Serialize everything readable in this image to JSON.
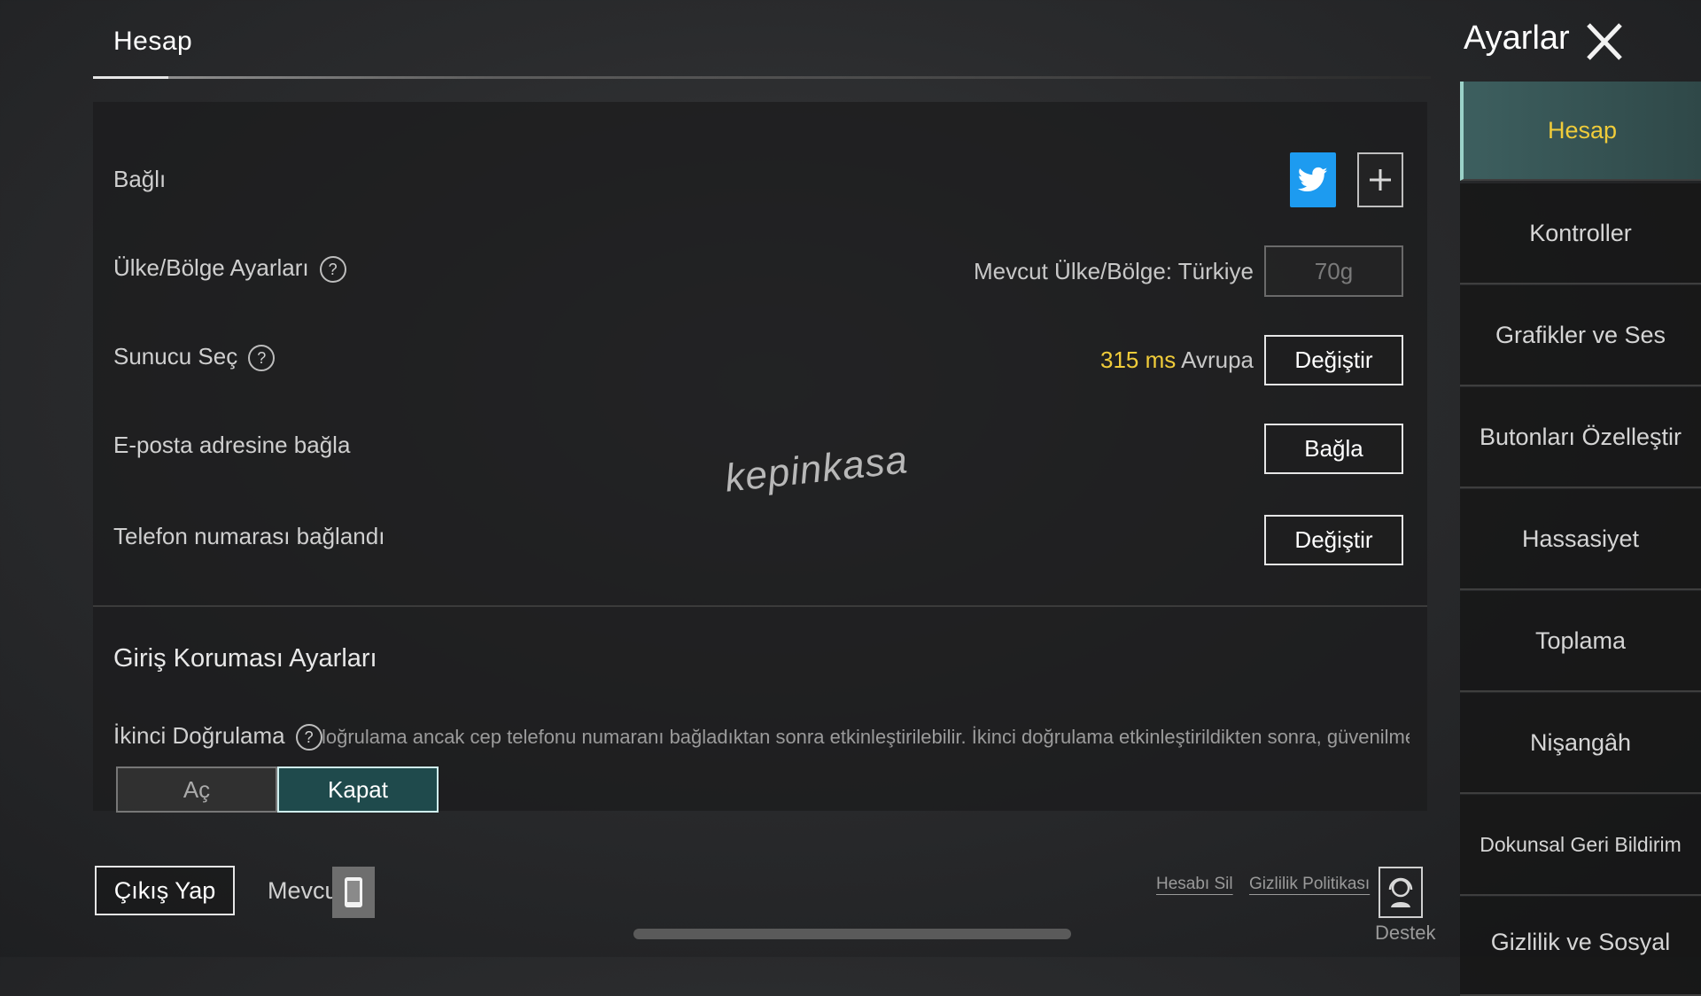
{
  "header": {
    "section_title": "Hesap"
  },
  "settings": {
    "title": "Ayarlar",
    "close_icon": "close-icon"
  },
  "rows": {
    "linked": {
      "label": "Bağlı",
      "twitter_icon": "twitter-icon",
      "add_icon": "plus-icon"
    },
    "region": {
      "label": "Ülke/Bölge Ayarları",
      "current": "Mevcut Ülke/Bölge: Türkiye",
      "button": "70g"
    },
    "server": {
      "label": "Sunucu Seç",
      "ping": "315 ms",
      "region": "Avrupa",
      "button": "Değiştir"
    },
    "email": {
      "label": "E-posta adresine bağla",
      "button": "Bağla"
    },
    "phone": {
      "label": "Telefon numarası bağlandı",
      "button": "Değiştir"
    }
  },
  "login_protection": {
    "title": "Giriş Koruması Ayarları",
    "second_auth_label": "İkinci Doğrulama",
    "second_auth_desc": "loğrulama ancak cep telefonu numaranı bağladıktan sonra etkinleştirilebilir. İkinci doğrulama etkinleştirildikten sonra, güvenilmeyen cihazlardan oyuna g",
    "on_label": "Aç",
    "off_label": "Kapat",
    "selected": "Kapat"
  },
  "bottom": {
    "logout": "Çıkış Yap",
    "current": "Mevcut",
    "delete_account": "Hesabı Sil",
    "privacy_policy": "Gizlilik Politikası",
    "support": "Destek"
  },
  "watermark": "kepinkasa",
  "sidebar": {
    "items": [
      {
        "label": "Hesap",
        "active": true
      },
      {
        "label": "Kontroller"
      },
      {
        "label": "Grafikler ve Ses"
      },
      {
        "label": "Butonları Özelleştir"
      },
      {
        "label": "Hassasiyet"
      },
      {
        "label": "Toplama"
      },
      {
        "label": "Nişangâh"
      },
      {
        "label": "Dokunsal Geri Bildirim"
      },
      {
        "label": "Gizlilik ve Sosyal"
      }
    ]
  },
  "colors": {
    "accent_yellow": "#f0cc3a",
    "twitter_blue": "#1d9bf0",
    "active_tab": "#3d5f5f"
  }
}
